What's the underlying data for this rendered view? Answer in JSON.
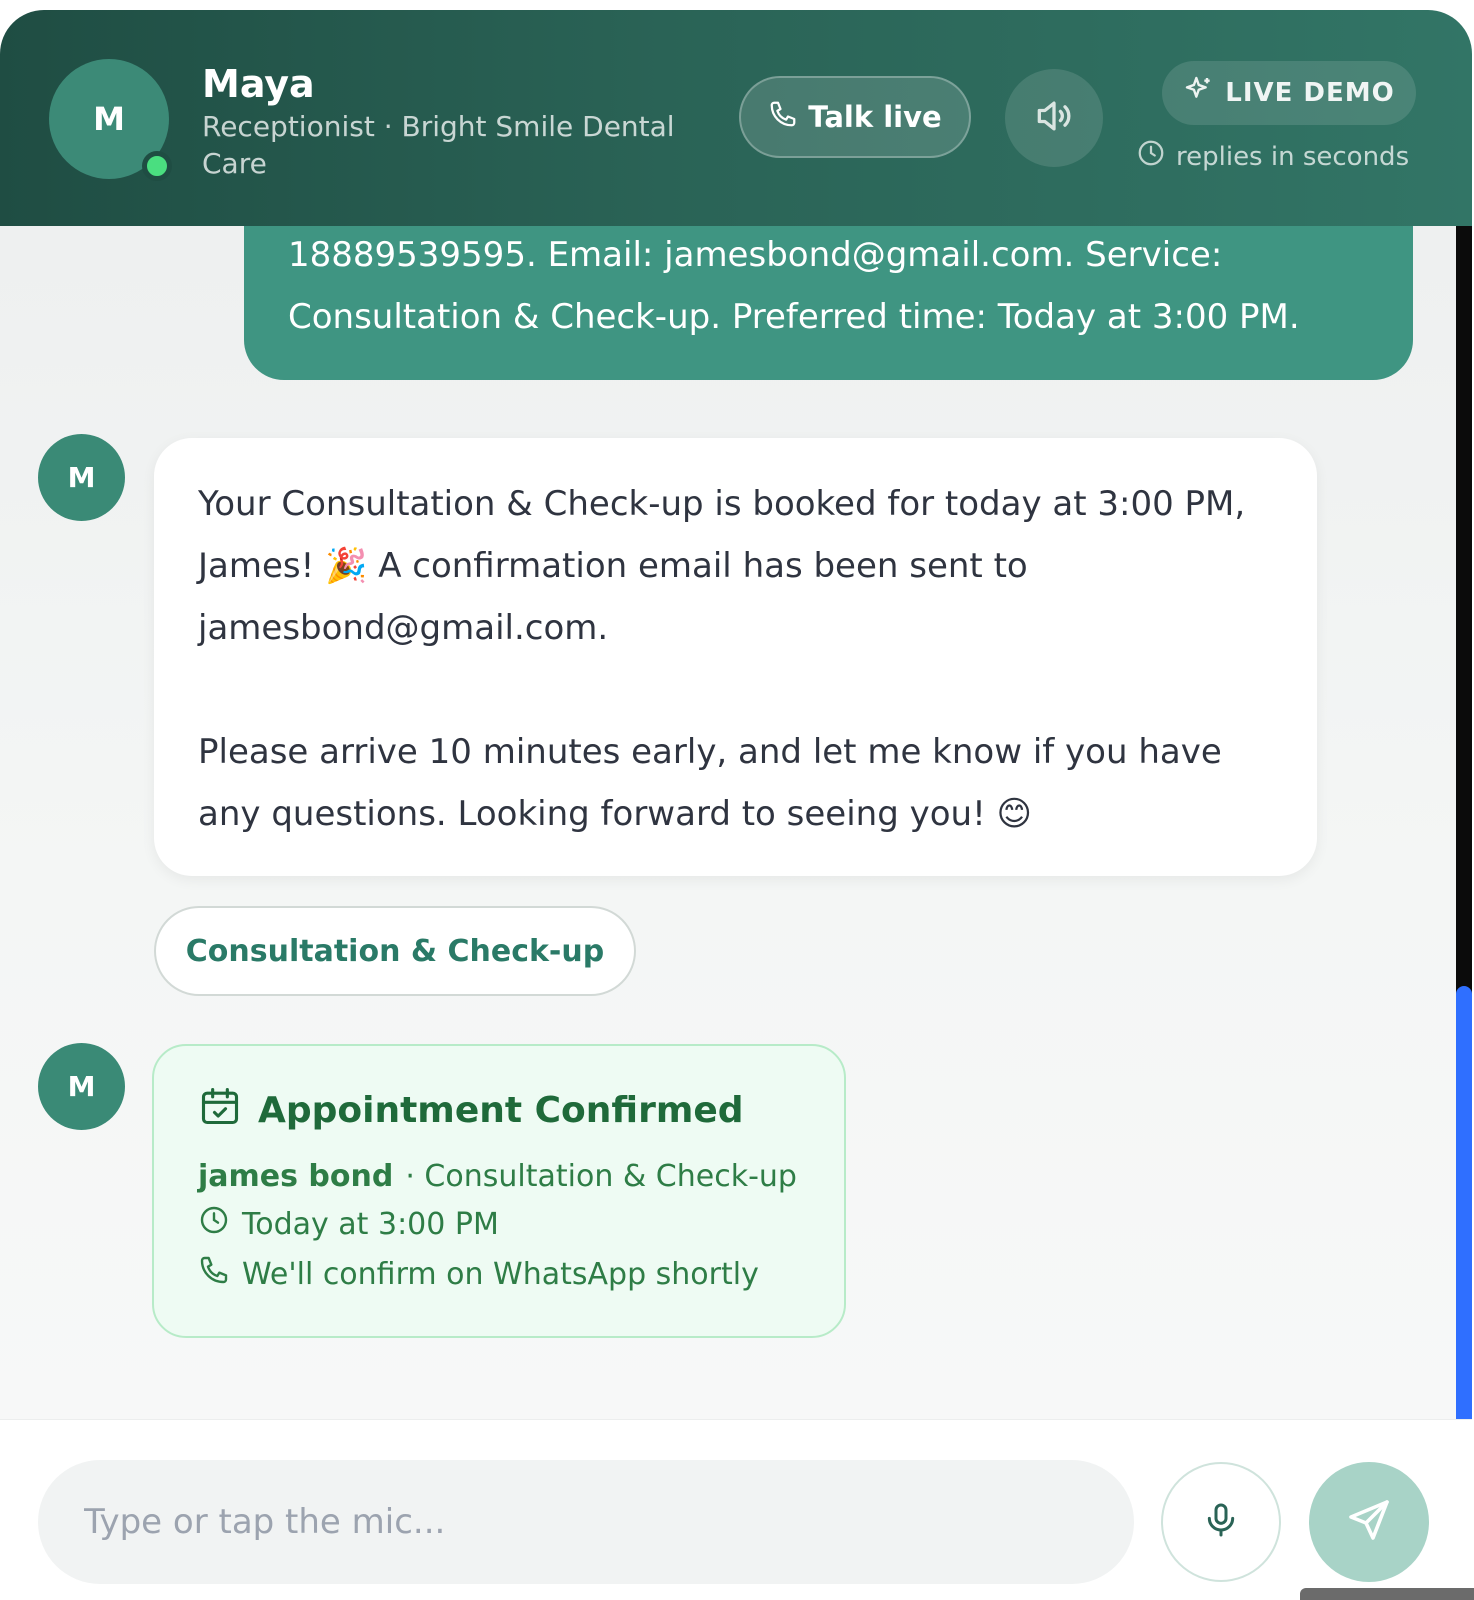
{
  "header": {
    "avatar_initial": "M",
    "agent_name": "Maya",
    "agent_role": "Receptionist · Bright Smile Dental Care",
    "talk_live_label": "Talk live",
    "live_demo_label": "LIVE DEMO",
    "replies_text": "replies in seconds"
  },
  "messages": {
    "user_message": "18889539595. Email: jamesbond@gmail.com. Service: Consultation & Check-up. Preferred time: Today at 3:00 PM.",
    "bot_avatar_initial": "M",
    "bot_message_p1": "Your Consultation & Check-up is booked for today at 3:00 PM, James! 🎉 A confirmation email has been sent to jamesbond@gmail.com.",
    "bot_message_p2": "Please arrive 10 minutes early, and let me know if you have any questions. Looking forward to seeing you! 😊",
    "quick_reply_chip": "Consultation & Check-up"
  },
  "confirmation": {
    "title": "Appointment Confirmed",
    "name": "james bond",
    "service": "· Consultation & Check-up",
    "time": "Today at 3:00 PM",
    "whatsapp_note": "We'll confirm on WhatsApp shortly"
  },
  "input": {
    "placeholder": "Type or tap the mic..."
  },
  "colors": {
    "header_dark": "#1f4d43",
    "brand_green": "#3f9582",
    "online": "#4ade80",
    "confirm_bg": "#eefbf3",
    "scroll_thumb": "#2f6fff"
  },
  "icons": {
    "talk": "phone-icon",
    "speaker": "speaker-icon",
    "live": "sparkle-icon",
    "replies": "clock-icon",
    "confirm": "calendar-check-icon",
    "time": "clock-icon",
    "whatsapp": "phone-icon",
    "mic": "mic-icon",
    "send": "send-icon"
  }
}
